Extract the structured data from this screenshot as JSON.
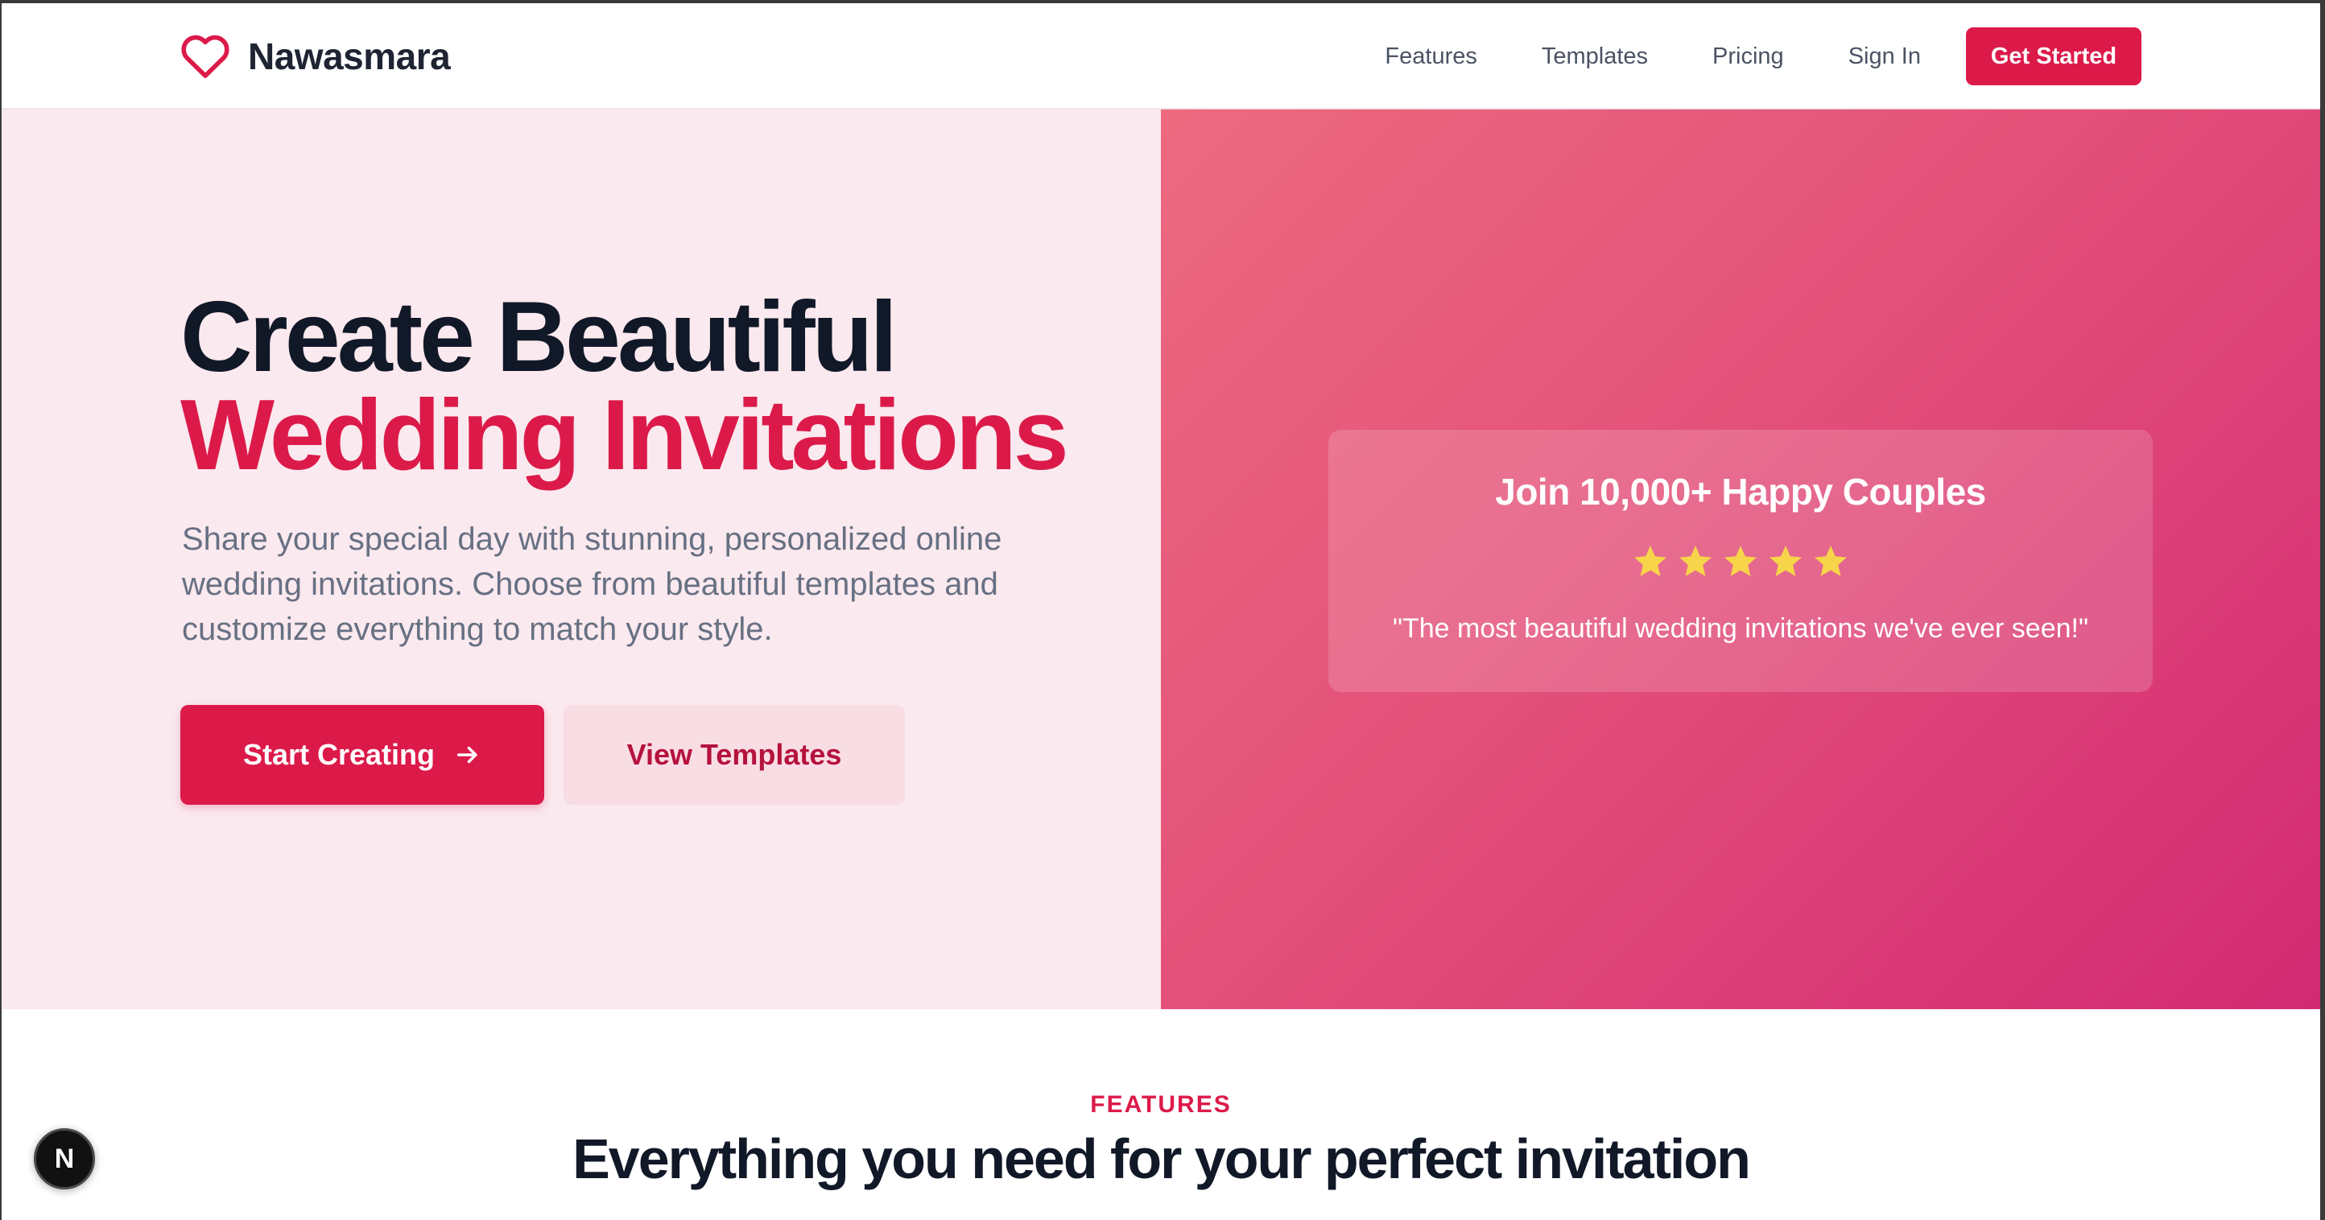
{
  "header": {
    "logo_text": "Nawasmara",
    "logo_icon": "heart-icon",
    "nav": [
      "Features",
      "Templates",
      "Pricing",
      "Sign In"
    ],
    "cta": "Get Started"
  },
  "hero": {
    "headline_line1": "Create Beautiful",
    "headline_line2": "Wedding Invitations",
    "subtext": "Share your special day with stunning, personalized online wedding invitations. Choose from beautiful templates and customize everything to match your style.",
    "primary_button": "Start Creating",
    "primary_button_icon": "arrow-right-icon",
    "secondary_button": "View Templates"
  },
  "testimonial": {
    "title": "Join 10,000+ Happy Couples",
    "rating_stars": 5,
    "quote": "\"The most beautiful wedding invitations we've ever seen!\""
  },
  "features": {
    "eyebrow": "FEATURES",
    "title": "Everything you need for your perfect invitation"
  },
  "dev_badge": {
    "label": "N"
  },
  "colors": {
    "brand": "#dc1a4a",
    "hero_left_bg": "#fae9ee",
    "hero_right_gradient_start": "#ec6a80",
    "hero_right_gradient_end": "#d22a72",
    "star": "#f7d44a",
    "heading": "#111827"
  }
}
